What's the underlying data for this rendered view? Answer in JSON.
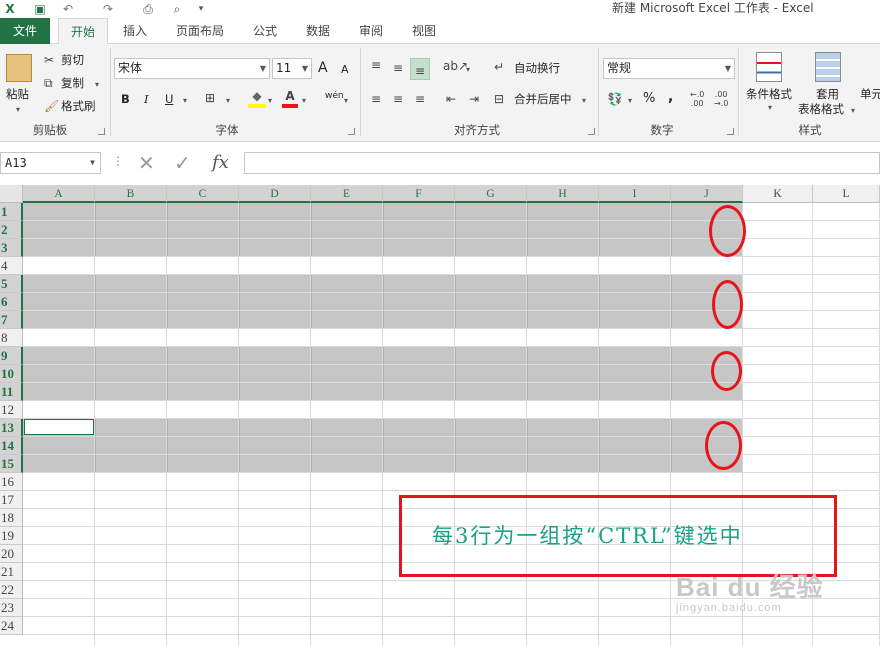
{
  "window": {
    "title": "新建 Microsoft Excel 工作表 - Excel"
  },
  "quick_access": {
    "logo_glyph": "X",
    "save_glyph": "▣",
    "undo_glyph": "↶",
    "redo_glyph": "↷",
    "preview_glyph": "⎙",
    "customize_glyph": "▾"
  },
  "tabs": {
    "file": "文件",
    "home": "开始",
    "insert": "插入",
    "page_layout": "页面布局",
    "formulas": "公式",
    "data": "数据",
    "review": "审阅",
    "view": "视图"
  },
  "ribbon": {
    "clipboard": {
      "paste": "粘贴",
      "cut": "剪切",
      "copy": "复制",
      "format_painter": "格式刷",
      "group_label": "剪贴板"
    },
    "font": {
      "font_name": "宋体",
      "font_size": "11",
      "grow": "A",
      "shrink": "A",
      "bold": "B",
      "italic": "I",
      "underline": "U",
      "phonetic": "wén",
      "group_label": "字体"
    },
    "alignment": {
      "wrap_text": "自动换行",
      "merge_center": "合并后居中",
      "group_label": "对齐方式"
    },
    "number": {
      "format": "常规",
      "percent": "%",
      "comma": ",",
      "group_label": "数字"
    },
    "styles": {
      "conditional_format": "条件格式",
      "table_format_line1": "套用",
      "table_format_line2": "表格格式",
      "cell_styles": "单元",
      "group_label": "样式"
    }
  },
  "formula_bar": {
    "name_box": "A13",
    "cancel_glyph": "✕",
    "enter_glyph": "✓",
    "fx": "fx",
    "value": ""
  },
  "grid": {
    "columns": [
      "A",
      "B",
      "C",
      "D",
      "E",
      "F",
      "G",
      "H",
      "I",
      "J",
      "K",
      "L"
    ],
    "rows": [
      "1",
      "2",
      "3",
      "4",
      "5",
      "6",
      "7",
      "8",
      "9",
      "10",
      "11",
      "12",
      "13",
      "14",
      "15",
      "16",
      "17",
      "18",
      "19",
      "20",
      "21",
      "22",
      "23",
      "24"
    ],
    "selected_rows": [
      "1",
      "2",
      "3",
      "5",
      "6",
      "7",
      "9",
      "10",
      "11",
      "13",
      "14",
      "15"
    ],
    "selected_columns": [
      "A",
      "B",
      "C",
      "D",
      "E",
      "F",
      "G",
      "H",
      "I",
      "J"
    ],
    "active_cell": "A13"
  },
  "annotation": {
    "note": "每3行为一组按“CTRL”键选中",
    "accent_color": "#e8141c",
    "note_color": "#1aa184"
  },
  "watermark": {
    "line1": "Bai du 经验",
    "line2": "jingyan.baidu.com"
  },
  "colors": {
    "excel_green": "#217346",
    "selection_gray": "#c6c6c6"
  }
}
